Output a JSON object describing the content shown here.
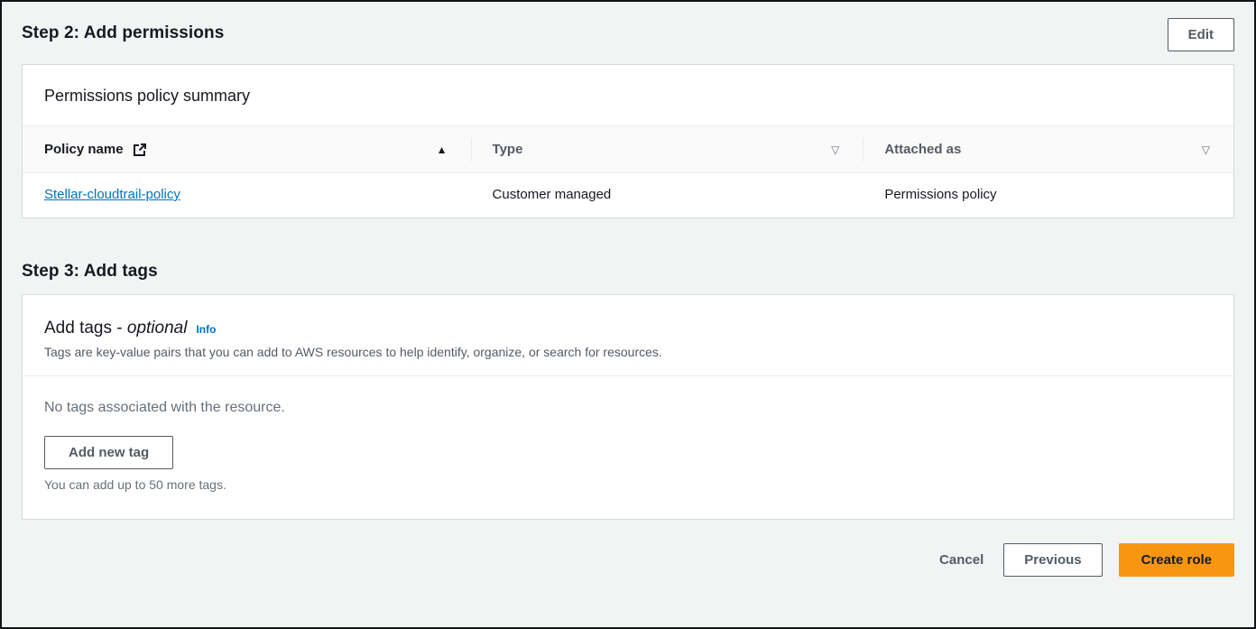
{
  "colors": {
    "accent_orange": "#f89611",
    "link_blue": "#0073bb",
    "page_bg": "#f2f3f3",
    "text_primary": "#16191f",
    "text_secondary": "#545b64"
  },
  "icons": {
    "sort_asc": "▲",
    "sort_desc_outline": "▽",
    "external_link": "external-link"
  },
  "step2": {
    "title": "Step 2: Add permissions",
    "edit_button": "Edit"
  },
  "permissions_summary": {
    "title": "Permissions policy summary",
    "table": {
      "columns": [
        {
          "label": "Policy name",
          "sorted": "ascending"
        },
        {
          "label": "Type",
          "sorted": "none"
        },
        {
          "label": "Attached as",
          "sorted": "none"
        }
      ],
      "rows": [
        {
          "policy_name": "Stellar-cloudtrail-policy",
          "type": "Customer managed",
          "attached_as": "Permissions policy"
        }
      ]
    }
  },
  "step3": {
    "title": "Step 3: Add tags"
  },
  "add_tags": {
    "title_main": "Add tags -",
    "title_optional": "optional",
    "info_link": "Info",
    "description": "Tags are key-value pairs that you can add to AWS resources to help identify, organize, or search for resources.",
    "empty_message": "No tags associated with the resource.",
    "add_button": "Add new tag",
    "constraint": "You can add up to 50 more tags."
  },
  "footer": {
    "cancel": "Cancel",
    "previous": "Previous",
    "create_role": "Create role"
  }
}
